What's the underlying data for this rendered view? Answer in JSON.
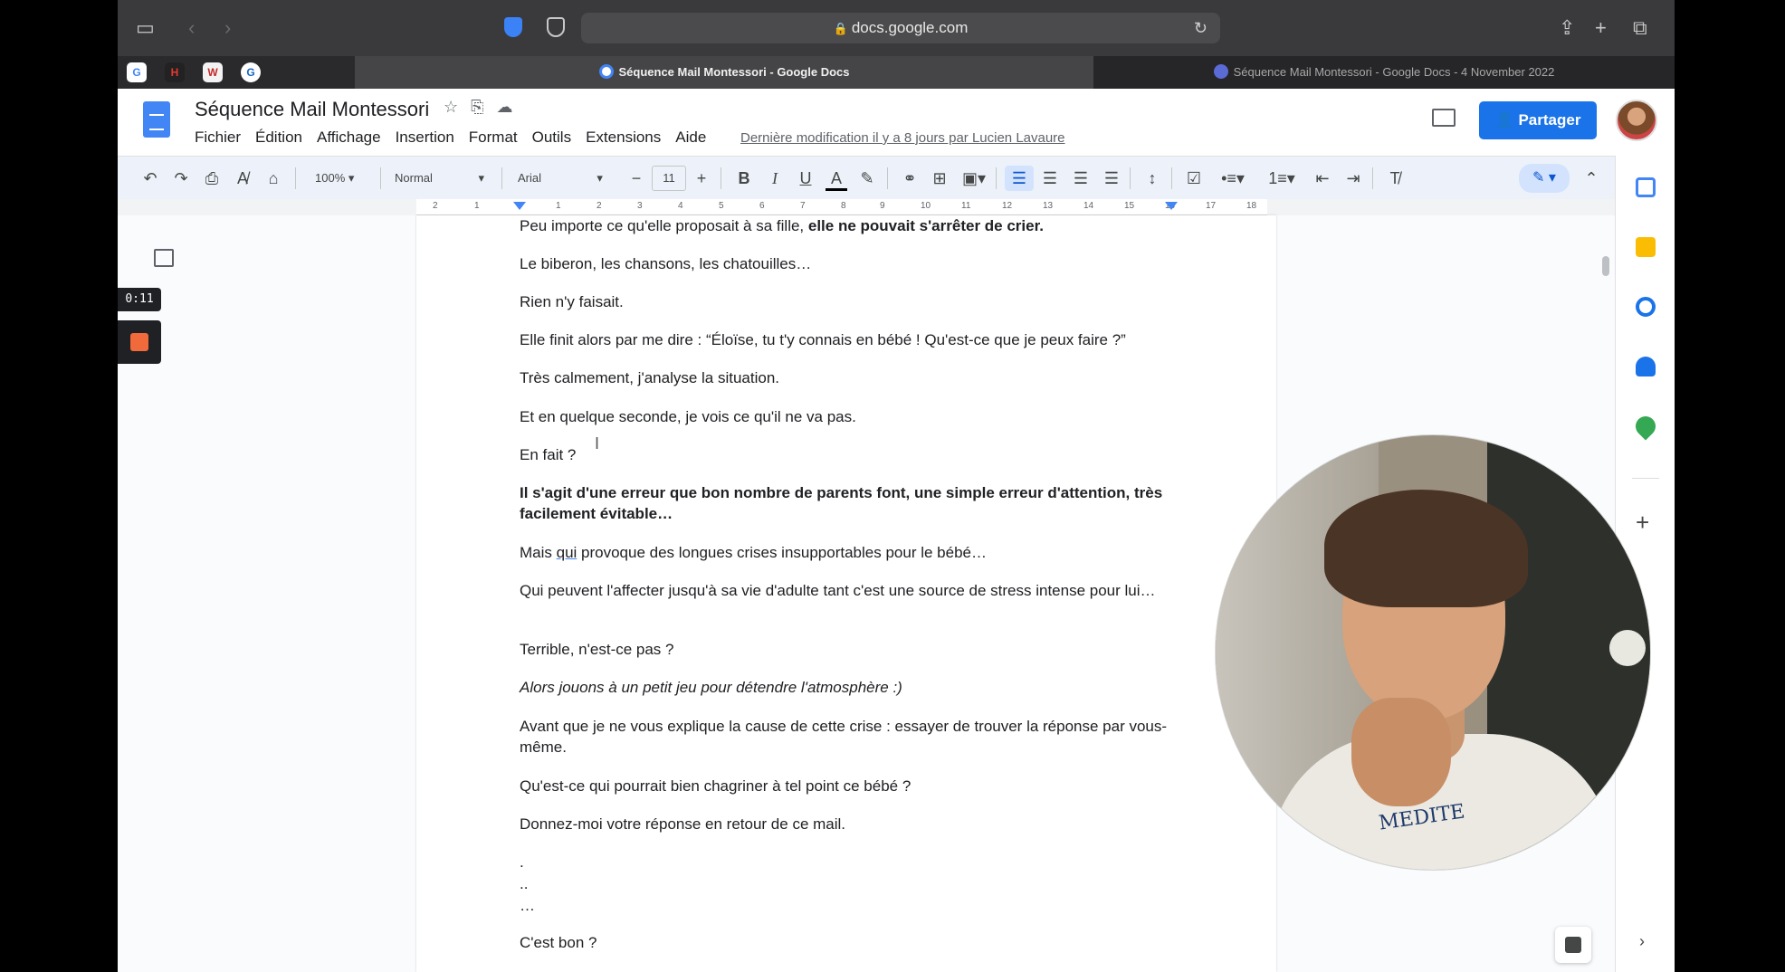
{
  "browser": {
    "url": "docs.google.com",
    "tabs": [
      {
        "label": "Séquence Mail Montessori - Google Docs",
        "active": true
      },
      {
        "label": "Séquence Mail Montessori - Google Docs - 4 November 2022",
        "active": false
      }
    ]
  },
  "doc": {
    "title": "Séquence Mail Montessori",
    "menu": [
      "Fichier",
      "Édition",
      "Affichage",
      "Insertion",
      "Format",
      "Outils",
      "Extensions",
      "Aide"
    ],
    "last_edit": "Dernière modification il y a 8 jours par Lucien Lavaure",
    "share_label": "Partager"
  },
  "toolbar": {
    "zoom": "100%",
    "style": "Normal",
    "font": "Arial",
    "font_size": "11"
  },
  "ruler": {
    "numbers": [
      "2",
      "1",
      "1",
      "2",
      "3",
      "4",
      "5",
      "6",
      "7",
      "8",
      "9",
      "10",
      "11",
      "12",
      "13",
      "14",
      "15",
      "16",
      "17",
      "18"
    ]
  },
  "recorder": {
    "time": "0:11"
  },
  "content": {
    "p1_normal": "Peu importe ce qu'elle proposait à sa fille, ",
    "p1_bold": "elle ne pouvait s'arrêter de crier.",
    "p2": "Le biberon, les chansons, les chatouilles…",
    "p3": "Rien n'y faisait.",
    "p4": "Elle finit alors par me dire : “Éloïse, tu t'y connais en bébé ! Qu'est-ce que je peux faire ?”",
    "p5": "Très calmement, j'analyse la situation.",
    "p6": "Et en quelque seconde, je vois ce qu'il ne va pas.",
    "p7": "En fait ?",
    "p8": "Il s'agit d'une erreur que bon nombre de parents font, une simple erreur d'attention, très facilement évitable…",
    "p9_a": "Mais ",
    "p9_b": "qui",
    "p9_c": " provoque des longues crises insupportables pour le bébé…",
    "p10": "Qui peuvent l'affecter jusqu'à sa vie d'adulte tant c'est une source de stress intense pour lui…",
    "p11": "Terrible, n'est-ce pas ?",
    "p12": "Alors jouons à un petit jeu pour détendre l'atmosphère :)",
    "p13": "Avant que je ne vous explique la cause de cette crise : essayer de trouver la réponse par vous-même.",
    "p14": "Qu'est-ce qui pourrait bien chagriner à tel point ce bébé ?",
    "p15": "Donnez-moi votre réponse en retour de ce mail.",
    "d1": ".",
    "d2": "..",
    "d3": "…",
    "p16": "C'est bon ?"
  },
  "webcam": {
    "shirt_text": "MEDITE"
  },
  "colors": {
    "accent": "#1a73e8",
    "docs_blue": "#4285f4",
    "record": "#f06a3c"
  }
}
